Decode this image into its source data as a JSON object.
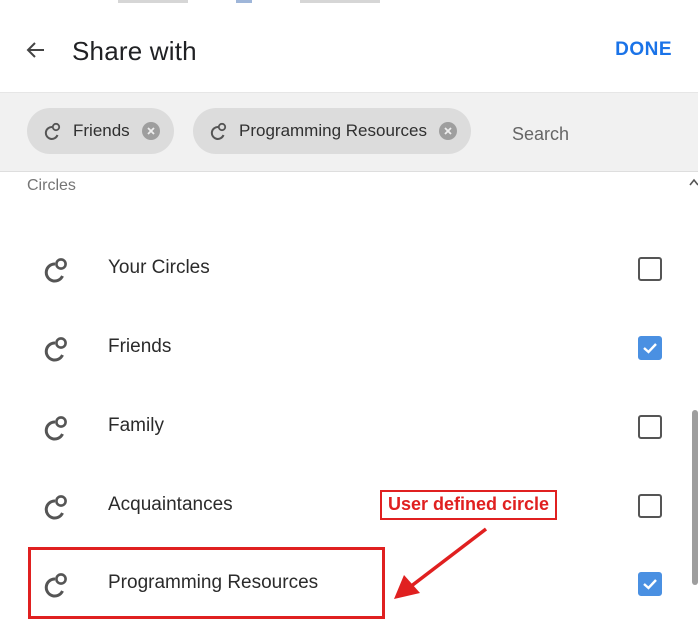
{
  "header": {
    "title": "Share with",
    "done_label": "DONE",
    "back_icon": "arrow-left-icon"
  },
  "chips": [
    {
      "label": "Friends",
      "icon": "circle-icon"
    },
    {
      "label": "Programming Resources",
      "icon": "circle-icon"
    }
  ],
  "search": {
    "placeholder": "Search",
    "value": ""
  },
  "section": {
    "label": "Circles"
  },
  "circles": [
    {
      "label": "Your Circles",
      "checked": false
    },
    {
      "label": "Friends",
      "checked": true
    },
    {
      "label": "Family",
      "checked": false
    },
    {
      "label": "Acquaintances",
      "checked": false
    },
    {
      "label": "Programming Resources",
      "checked": true
    }
  ],
  "annotation": {
    "label": "User defined circle",
    "color": "#e02020"
  },
  "colors": {
    "accent": "#1a73e8",
    "checkbox": "#4a90e2",
    "chip_bg": "#dcdcdc"
  }
}
